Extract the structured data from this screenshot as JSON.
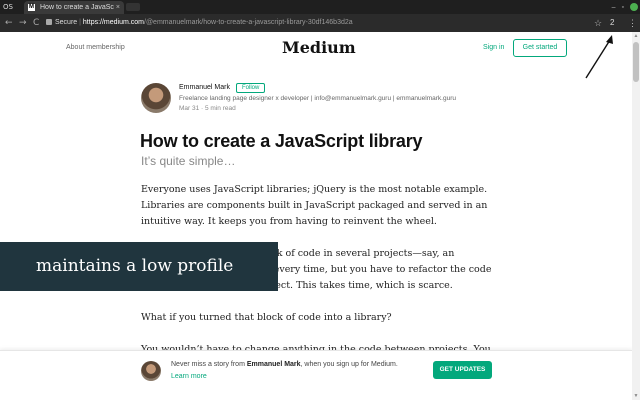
{
  "browser": {
    "chrome_logo": "OS",
    "tab_title": "How to create a JavaSc",
    "tab_favicon": "M",
    "tab_close": "×",
    "back": "←",
    "forward": "→",
    "reload": "C",
    "secure_label": "Secure",
    "url_scheme": "https://",
    "url_host": "medium.com",
    "url_path": "/@emmanuelmark/how-to-create-a-javascript-library-30df146b3d2a",
    "star": "☆",
    "extension_badge": "2",
    "menu": "⋮",
    "win_minimize": "–",
    "win_maximize": "▫"
  },
  "header": {
    "about": "About membership",
    "logo": "Medium",
    "sign_in": "Sign in",
    "get_started": "Get started"
  },
  "author": {
    "name": "Emmanuel Mark",
    "follow": "Follow",
    "bio": "Freelance landing page designer x developer | info@emmanuelmark.guru | emmanuelmark.guru",
    "meta": "Mar 31 · 5 min read"
  },
  "article": {
    "title": "How to create a JavaScript library",
    "subtitle": "It’s quite simple…",
    "p1": "Everyone uses JavaScript libraries; jQuery is the most notable example. Libraries are components built in JavaScript packaged and served in an intuitive way. It keeps you from having to reinvent the wheel.",
    "p2": "Say you need a specific block of code in several projects—say, an animation. You can write it every time, but you have to refactor the code to fit it into the current project. This takes time, which is scarce.",
    "p3": "What if you turned that block of code into a library?",
    "p4": "You wouldn’t have to change anything in the code between projects. You"
  },
  "overlay": {
    "text": "maintains a low profile"
  },
  "banner": {
    "text_prefix": "Never miss a story from ",
    "author_name": "Emmanuel Mark",
    "text_suffix": ", when you sign up for Medium. ",
    "learn_more": "Learn more",
    "button": "GET UPDATES"
  },
  "scrollbar": {
    "up": "▲",
    "down": "▼"
  },
  "colors": {
    "accent": "#03a87c",
    "overlay_bg": "#20353e"
  }
}
